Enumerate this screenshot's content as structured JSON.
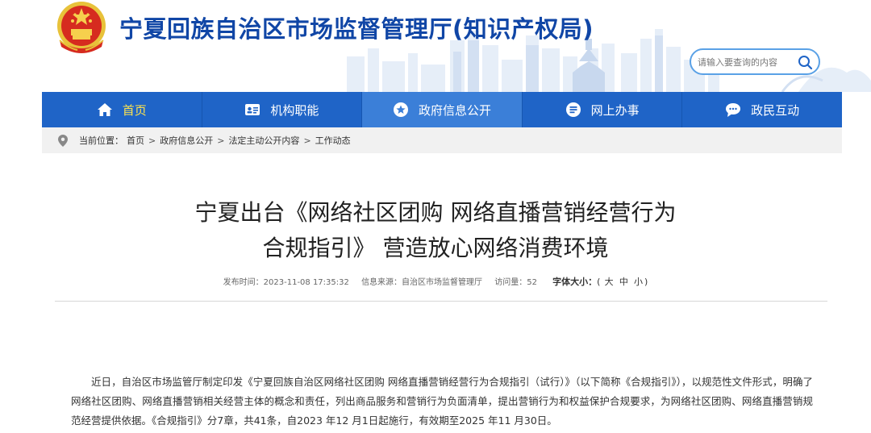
{
  "site": {
    "title": "宁夏回族自治区市场监督管理厅(知识产权局)"
  },
  "search": {
    "placeholder": "请输入要查询的内容"
  },
  "nav": {
    "items": [
      {
        "label": "首页",
        "icon": "home-icon"
      },
      {
        "label": "机构职能",
        "icon": "id-card-icon"
      },
      {
        "label": "政府信息公开",
        "icon": "star-icon"
      },
      {
        "label": "网上办事",
        "icon": "list-icon"
      },
      {
        "label": "政民互动",
        "icon": "chat-icon"
      }
    ]
  },
  "breadcrumb": {
    "prefix": "当前位置：",
    "items": [
      "首页",
      "政府信息公开",
      "法定主动公开内容",
      "工作动态"
    ],
    "separator": ">"
  },
  "article": {
    "title_line1": "宁夏出台《网络社区团购 网络直播营销经营行为",
    "title_line2": "合规指引》 营造放心网络消费环境",
    "publish_time": "发布时间：2023-11-08 17:35:32",
    "source": "信息来源：自治区市场监督管理厅",
    "visits": "访问量：52",
    "font_size_label": "字体大小：",
    "font_size_open": "(",
    "font_size_large": "大",
    "font_size_medium": "中",
    "font_size_small": "小",
    "font_size_close": ")",
    "paragraph": "近日，自治区市场监管厅制定印发《宁夏回族自治区网络社区团购 网络直播营销经营行为合规指引（试行）》（以下简称《合规指引》），以规范性文件形式，明确了网络社区团购、网络直播营销相关经营主体的概念和责任，列出商品服务和营销行为负面清单，提出营销行为和权益保护合规要求，为网络社区团购、网络直播营销规范经营提供依据。《合规指引》分7章，共41条，自2023 年12 月1日起施行，有效期至2025 年11 月30日。"
  },
  "colors": {
    "brand_blue": "#1046a6",
    "nav_blue": "#1f64c7",
    "home_yellow": "#ffe44d",
    "breadcrumb_bg": "#f1f1f1"
  }
}
